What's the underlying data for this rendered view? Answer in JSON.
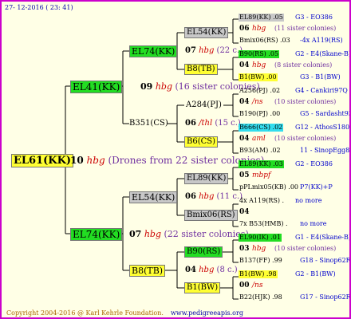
{
  "header": "27- 12-2016 ( 23: 41)",
  "footer_left": "Copyright 2004-2016 @ Karl Kehrle Foundation.",
  "footer_right": "www.pedigreeapis.org",
  "root": {
    "name": "EL61(KK)",
    "num": "10",
    "hbg": "hbg",
    "note": "(Drones from 22 sister colonies)"
  },
  "upper": {
    "name": "EL41(KK)",
    "num": "09",
    "hbg": "hbg",
    "note": "(16 sister colonies)",
    "a": {
      "name": "EL74(KK)",
      "num": "07",
      "hbg": "hbg",
      "note": "(22 c.)",
      "p1": "EL54(KK)",
      "p2": "B8(TB)"
    },
    "b": {
      "name": "B351(CS)",
      "num": "06",
      "hbg": "/thl",
      "note": "(15 c.)",
      "p1": "A284(PJ)",
      "p2": "B6(CS)"
    }
  },
  "lower": {
    "name": "EL74(KK)",
    "num": "07",
    "hbg": "hbg",
    "note": "(22 sister colonies)",
    "a": {
      "name": "EL54(KK)",
      "num": "06",
      "hbg": "hbg",
      "note": "(11 c.)",
      "p1": "EL89(KK)",
      "p2": "Bmix06(RS)"
    },
    "b": {
      "name": "B8(TB)",
      "num": "04",
      "hbg": "hbg",
      "note": "(8 c.)",
      "p1": "B90(RS)",
      "p2": "B1(BW)"
    }
  },
  "right": [
    {
      "top": "EL89(KK) .05",
      "topcode": "G3 - EO386",
      "num": "06",
      "hbg": "hbg",
      "note": "(11 sister colonies)",
      "bot": "Bmix06(RS) .03",
      "botcode": "-4x A119(RS)"
    },
    {
      "top": "B90(RS) .05",
      "topcode": "G2 - E4(Skane-B)",
      "num": "04",
      "hbg": "hbg",
      "note": "(8 sister colonies)",
      "bot": "B1(BW) .00",
      "botcode": "G3 - B1(BW)"
    },
    {
      "top": "A256(PJ) .02",
      "topcode": "G4 - Cankiri97Q",
      "num": "04",
      "hbg": "/ns",
      "note": "(10 sister colonies)",
      "bot": "B190(PJ) .00",
      "botcode": "G5 - Sardasht93R"
    },
    {
      "top": "B666(CS) .02",
      "topcode": "G12 - AthosS180R",
      "num": "04",
      "hbg": "aml",
      "note": "(10 sister colonies)",
      "bot": "B93(AM) .02",
      "botcode": "11 - SinopEgg86R"
    },
    {
      "top": "EL89(KK) .03",
      "topcode": "G2 - EO386",
      "num": "05",
      "hbg": "mbpf",
      "note": "",
      "bot": "pPLmix05(KB) .00",
      "botcode": "P7(KK)+P"
    },
    {
      "top": "4x A119(RS) .",
      "topcode": "no more",
      "num": "04",
      "hbg": "",
      "note": "",
      "bot": "7x B53(HMB) .",
      "botcode": "no more"
    },
    {
      "top": "EL90(IK) .01",
      "topcode": "G1 - E4(Skane-B)",
      "num": "03",
      "hbg": "hbg",
      "note": "(10 sister colonies)",
      "bot": "B137(FF) .99",
      "botcode": "G18 - Sinop62R"
    },
    {
      "top": "B1(BW) .98",
      "topcode": "G2 - B1(BW)",
      "num": "00",
      "hbg": "/ns",
      "note": "",
      "bot": "B22(HJK) .98",
      "botcode": "G17 - Sinop62R"
    }
  ]
}
